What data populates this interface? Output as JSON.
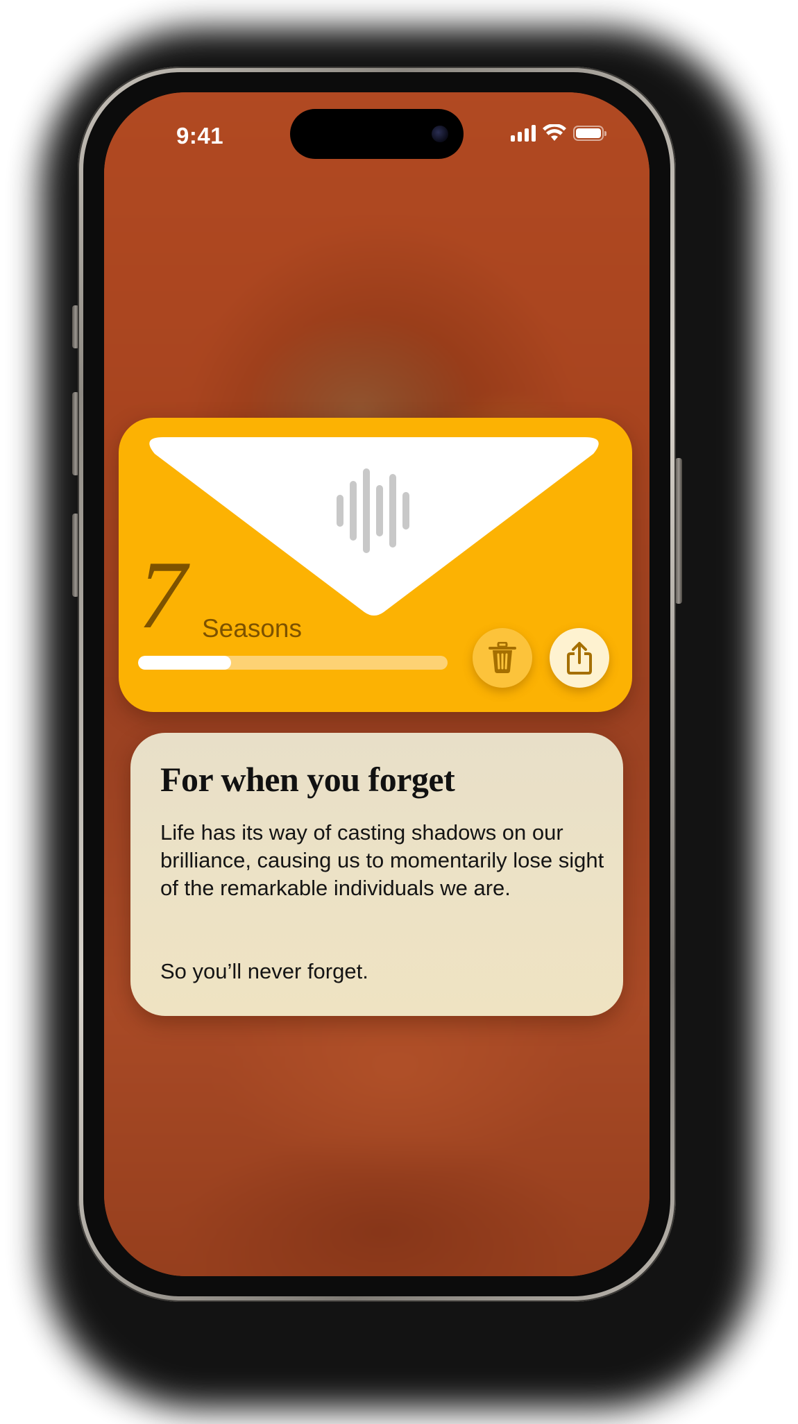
{
  "status_bar": {
    "time": "9:41",
    "signal_icon": "cellular-signal-icon",
    "wifi_icon": "wifi-icon",
    "battery_icon": "battery-icon",
    "battery_level": 1.0
  },
  "envelope_card": {
    "count": "7",
    "count_label": "Seasons",
    "progress": 0.3,
    "audio_icon": "waveform-icon",
    "delete_icon": "trash-icon",
    "share_icon": "share-icon",
    "colors": {
      "card": "#fcb203",
      "flap": "#ffffff",
      "text": "#7d5200",
      "progress_track": "#fdd274",
      "progress_fill": "#ffffff"
    }
  },
  "note_card": {
    "title": "For when you forget",
    "body": "Life has its way of casting shadows on our brilliance, causing us to momentarily lose sight of the remarkable individuals we are.",
    "closing": "So you’ll never forget."
  }
}
